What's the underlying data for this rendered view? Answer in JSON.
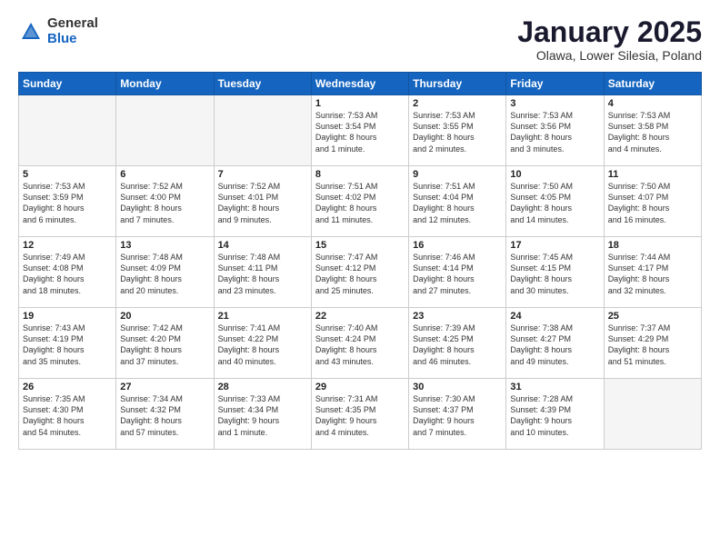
{
  "logo": {
    "general": "General",
    "blue": "Blue"
  },
  "title": "January 2025",
  "subtitle": "Olawa, Lower Silesia, Poland",
  "headers": [
    "Sunday",
    "Monday",
    "Tuesday",
    "Wednesday",
    "Thursday",
    "Friday",
    "Saturday"
  ],
  "weeks": [
    [
      {
        "date": "",
        "info": ""
      },
      {
        "date": "",
        "info": ""
      },
      {
        "date": "",
        "info": ""
      },
      {
        "date": "1",
        "info": "Sunrise: 7:53 AM\nSunset: 3:54 PM\nDaylight: 8 hours\nand 1 minute."
      },
      {
        "date": "2",
        "info": "Sunrise: 7:53 AM\nSunset: 3:55 PM\nDaylight: 8 hours\nand 2 minutes."
      },
      {
        "date": "3",
        "info": "Sunrise: 7:53 AM\nSunset: 3:56 PM\nDaylight: 8 hours\nand 3 minutes."
      },
      {
        "date": "4",
        "info": "Sunrise: 7:53 AM\nSunset: 3:58 PM\nDaylight: 8 hours\nand 4 minutes."
      }
    ],
    [
      {
        "date": "5",
        "info": "Sunrise: 7:53 AM\nSunset: 3:59 PM\nDaylight: 8 hours\nand 6 minutes."
      },
      {
        "date": "6",
        "info": "Sunrise: 7:52 AM\nSunset: 4:00 PM\nDaylight: 8 hours\nand 7 minutes."
      },
      {
        "date": "7",
        "info": "Sunrise: 7:52 AM\nSunset: 4:01 PM\nDaylight: 8 hours\nand 9 minutes."
      },
      {
        "date": "8",
        "info": "Sunrise: 7:51 AM\nSunset: 4:02 PM\nDaylight: 8 hours\nand 11 minutes."
      },
      {
        "date": "9",
        "info": "Sunrise: 7:51 AM\nSunset: 4:04 PM\nDaylight: 8 hours\nand 12 minutes."
      },
      {
        "date": "10",
        "info": "Sunrise: 7:50 AM\nSunset: 4:05 PM\nDaylight: 8 hours\nand 14 minutes."
      },
      {
        "date": "11",
        "info": "Sunrise: 7:50 AM\nSunset: 4:07 PM\nDaylight: 8 hours\nand 16 minutes."
      }
    ],
    [
      {
        "date": "12",
        "info": "Sunrise: 7:49 AM\nSunset: 4:08 PM\nDaylight: 8 hours\nand 18 minutes."
      },
      {
        "date": "13",
        "info": "Sunrise: 7:48 AM\nSunset: 4:09 PM\nDaylight: 8 hours\nand 20 minutes."
      },
      {
        "date": "14",
        "info": "Sunrise: 7:48 AM\nSunset: 4:11 PM\nDaylight: 8 hours\nand 23 minutes."
      },
      {
        "date": "15",
        "info": "Sunrise: 7:47 AM\nSunset: 4:12 PM\nDaylight: 8 hours\nand 25 minutes."
      },
      {
        "date": "16",
        "info": "Sunrise: 7:46 AM\nSunset: 4:14 PM\nDaylight: 8 hours\nand 27 minutes."
      },
      {
        "date": "17",
        "info": "Sunrise: 7:45 AM\nSunset: 4:15 PM\nDaylight: 8 hours\nand 30 minutes."
      },
      {
        "date": "18",
        "info": "Sunrise: 7:44 AM\nSunset: 4:17 PM\nDaylight: 8 hours\nand 32 minutes."
      }
    ],
    [
      {
        "date": "19",
        "info": "Sunrise: 7:43 AM\nSunset: 4:19 PM\nDaylight: 8 hours\nand 35 minutes."
      },
      {
        "date": "20",
        "info": "Sunrise: 7:42 AM\nSunset: 4:20 PM\nDaylight: 8 hours\nand 37 minutes."
      },
      {
        "date": "21",
        "info": "Sunrise: 7:41 AM\nSunset: 4:22 PM\nDaylight: 8 hours\nand 40 minutes."
      },
      {
        "date": "22",
        "info": "Sunrise: 7:40 AM\nSunset: 4:24 PM\nDaylight: 8 hours\nand 43 minutes."
      },
      {
        "date": "23",
        "info": "Sunrise: 7:39 AM\nSunset: 4:25 PM\nDaylight: 8 hours\nand 46 minutes."
      },
      {
        "date": "24",
        "info": "Sunrise: 7:38 AM\nSunset: 4:27 PM\nDaylight: 8 hours\nand 49 minutes."
      },
      {
        "date": "25",
        "info": "Sunrise: 7:37 AM\nSunset: 4:29 PM\nDaylight: 8 hours\nand 51 minutes."
      }
    ],
    [
      {
        "date": "26",
        "info": "Sunrise: 7:35 AM\nSunset: 4:30 PM\nDaylight: 8 hours\nand 54 minutes."
      },
      {
        "date": "27",
        "info": "Sunrise: 7:34 AM\nSunset: 4:32 PM\nDaylight: 8 hours\nand 57 minutes."
      },
      {
        "date": "28",
        "info": "Sunrise: 7:33 AM\nSunset: 4:34 PM\nDaylight: 9 hours\nand 1 minute."
      },
      {
        "date": "29",
        "info": "Sunrise: 7:31 AM\nSunset: 4:35 PM\nDaylight: 9 hours\nand 4 minutes."
      },
      {
        "date": "30",
        "info": "Sunrise: 7:30 AM\nSunset: 4:37 PM\nDaylight: 9 hours\nand 7 minutes."
      },
      {
        "date": "31",
        "info": "Sunrise: 7:28 AM\nSunset: 4:39 PM\nDaylight: 9 hours\nand 10 minutes."
      },
      {
        "date": "",
        "info": ""
      }
    ]
  ]
}
